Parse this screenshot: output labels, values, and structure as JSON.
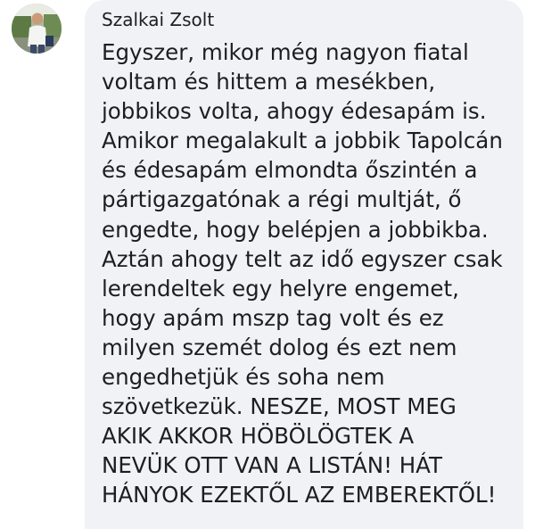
{
  "comment": {
    "author": "Szalkai Zsolt",
    "lines": [
      "Egyszer, mikor még nagyon fiatal",
      "voltam és hittem a mesékben,",
      "jobbikos volta, ahogy édesapám is.",
      "Amikor megalakult a jobbik Tapolcán",
      "és édesapám elmondta őszintén a",
      "pártigazgatónak a régi multját, ő",
      "engedte, hogy belépjen a jobbikba.",
      "Aztán ahogy telt az idő egyszer csak",
      "lerendeltek egy helyre engemet,",
      "hogy apám mszp tag volt és ez",
      "milyen szemét dolog és ezt nem",
      "engedhetjük és soha nem",
      "szövetkezük. NESZE, MOST MEG",
      "AKIK AKKOR HÖBÖLÖGTEK A",
      "NEVÜK OTT VAN A LISTÁN! HÁT",
      "HÁNYOK EZEKTŐL AZ EMBEREKTŐL!"
    ]
  },
  "colors": {
    "bubble": "#f0f2f5",
    "text": "#1c1e21"
  }
}
